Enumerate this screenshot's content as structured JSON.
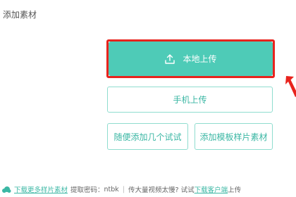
{
  "panel": {
    "title": "添加素材"
  },
  "buttons": {
    "local_upload": "本地上传",
    "mobile_upload": "手机上传",
    "random_add": "随便添加几个试试",
    "add_template": "添加模板样片素材"
  },
  "icons": {
    "upload": "upload-icon",
    "cloud": "cloud-icon",
    "arrow": "pointer-arrow"
  },
  "footer": {
    "download_samples": "下载更多样片素材",
    "extract_code_label": "提取密码：",
    "extract_code": "ntbk",
    "slow_prefix": "传大量视频太慢? 试试",
    "client_link": "下载客户端",
    "slow_suffix": "上传"
  },
  "colors": {
    "primary": "#4ecbb7",
    "highlight": "#e8231d",
    "outline_border": "#8fddcf",
    "outline_text": "#3bb7a4"
  }
}
